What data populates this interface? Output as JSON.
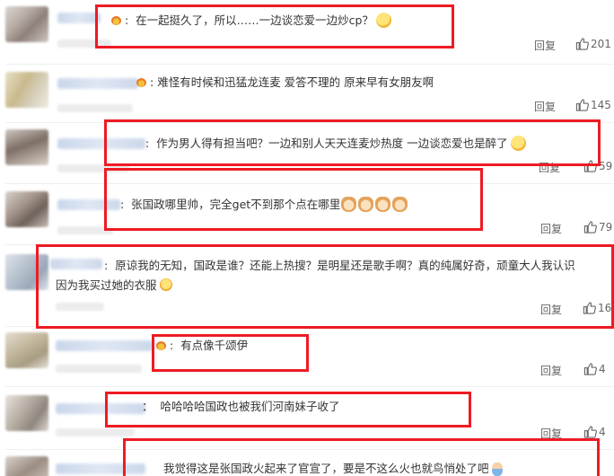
{
  "colors": {
    "highlight": "#ee1b24",
    "text": "#333333",
    "action": "#666666"
  },
  "comments": [
    {
      "text": "在一起挺久了，所以……一边谈恋爱一边炒cp？",
      "reply": "回复",
      "likes": "201",
      "badge": "crown-icon",
      "emoji": "smirk-emoji"
    },
    {
      "text": "难怪有时候和迅猛龙连麦 爱答不理的 原来早有女朋友啊",
      "reply": "回复",
      "likes": "145",
      "badge": "crown-icon"
    },
    {
      "text": "作为男人得有担当吧？一边和别人天天连麦炒热度 一边谈恋爱也是醉了",
      "reply": "回复",
      "likes": "59",
      "emoji": "sweat-smile-emoji"
    },
    {
      "text": "张国政哪里帅，完全get不到那个点在哪里",
      "reply": "回复",
      "likes": "79",
      "emoji": "cat-emoji"
    },
    {
      "text_line1": "原谅我的无知，国政是谁？还能上热搜？是明星还是歌手啊？真的纯属好奇，顽童大人我认识",
      "text_line2": "因为我买过她的衣服",
      "reply": "回复",
      "likes": "16",
      "emoji": "laugh-emoji"
    },
    {
      "text": "有点像千颂伊",
      "reply": "回复",
      "likes": "4",
      "badge": "crown-icon"
    },
    {
      "text": "哈哈哈哈国政也被我们河南妹子收了",
      "reply": "回复",
      "likes": "4"
    },
    {
      "text": "我觉得这是张国政火起来了官宣了，要是不这么火也就鸟悄处了吧",
      "emoji": "person-emoji"
    }
  ]
}
